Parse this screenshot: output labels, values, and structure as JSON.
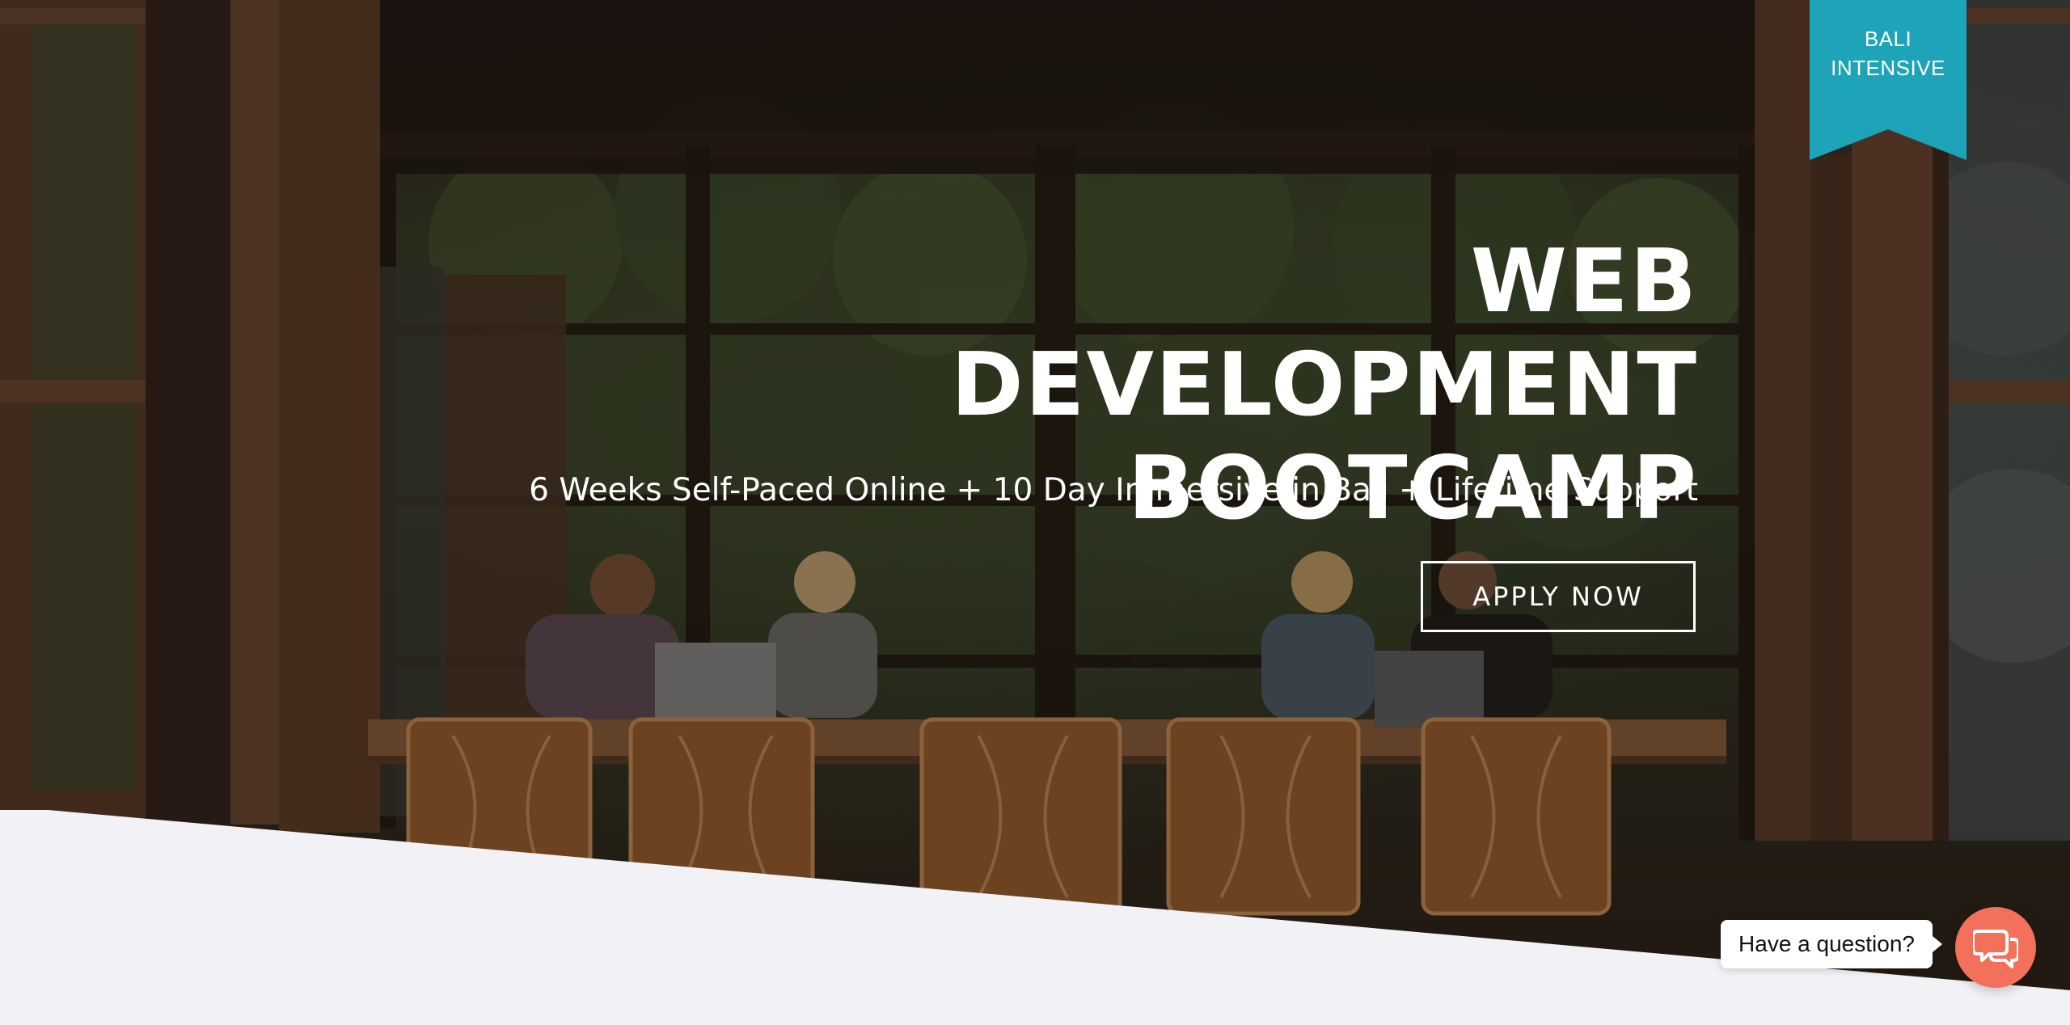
{
  "ribbon": {
    "line1": "BALI",
    "line2": "INTENSIVE",
    "color": "#1ea4b8"
  },
  "hero": {
    "title_line1": "WEB DEVELOPMENT",
    "title_line2": "BOOTCAMP",
    "subtitle": "6 Weeks Self-Paced Online + 10 Day Immersive in Bali + Lifetime Support",
    "cta_label": "APPLY NOW"
  },
  "chat": {
    "prompt": "Have a question?",
    "launcher_color": "#f3705a",
    "icon": "chat-bubbles-icon"
  },
  "colors": {
    "bottom_section": "#f2f1f5",
    "text": "#ffffff"
  }
}
